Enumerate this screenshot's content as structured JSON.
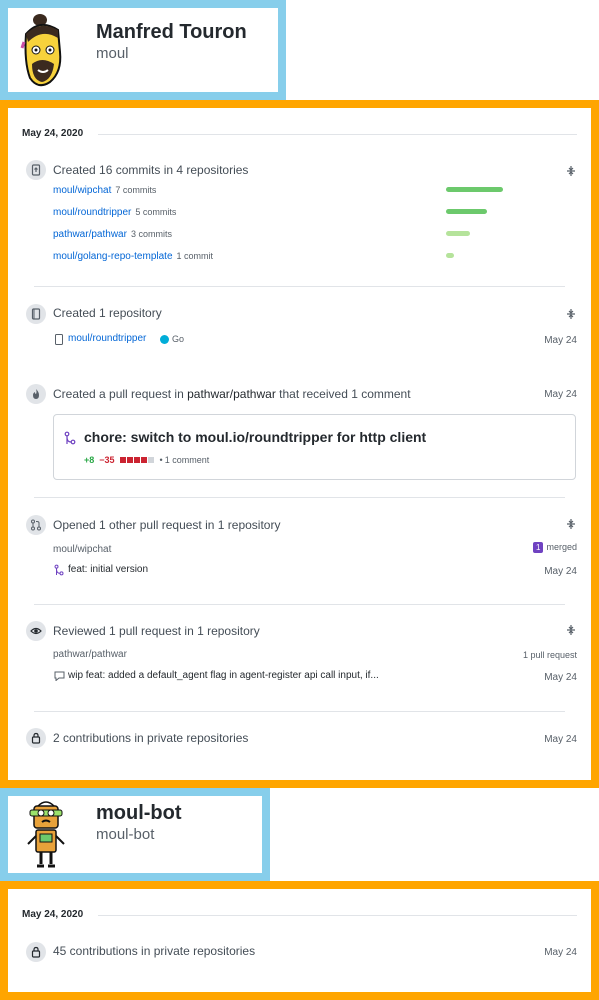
{
  "users": [
    {
      "name": "Manfred Touron",
      "login": "moul",
      "date_header": "May 24, 2020",
      "commits_event": {
        "title": "Created 16 commits in 4 repositories",
        "repos": [
          {
            "name": "moul/wipchat",
            "count": "7 commits",
            "commits": 7
          },
          {
            "name": "moul/roundtripper",
            "count": "5 commits",
            "commits": 5
          },
          {
            "name": "pathwar/pathwar",
            "count": "3 commits",
            "commits": 3
          },
          {
            "name": "moul/golang-repo-template",
            "count": "1 commit",
            "commits": 1
          }
        ]
      },
      "repo_event": {
        "title": "Created 1 repository",
        "repo_name": "moul/roundtripper",
        "language": "Go",
        "language_color": "#00ADD8",
        "date": "May 24"
      },
      "pr_event": {
        "title_prefix": "Created a pull request in",
        "repo": "pathwar/pathwar",
        "title_suffix": "that received 1 comment",
        "date": "May 24",
        "pr_title": "chore: switch to moul.io/roundtripper for http client",
        "additions": "+8",
        "deletions": "−35",
        "comments": "1 comment"
      },
      "opened_event": {
        "title": "Opened 1 other pull request in 1 repository",
        "repo": "moul/wipchat",
        "badge_count": "1",
        "badge_label": "merged",
        "pr_title": "feat: initial version",
        "date": "May 24"
      },
      "review_event": {
        "title": "Reviewed 1 pull request in 1 repository",
        "repo": "pathwar/pathwar",
        "count_label": "1 pull request",
        "pr_title": "wip feat: added a default_agent flag in agent-register api call input, if...",
        "date": "May 24"
      },
      "private_event": {
        "title": "2 contributions in private repositories",
        "date": "May 24"
      }
    },
    {
      "name": "moul-bot",
      "login": "moul-bot",
      "date_header": "May 24, 2020",
      "private_event": {
        "title": "45 contributions in private repositories",
        "date": "May 24"
      }
    }
  ],
  "colors": {
    "profile_border": "#87ceeb",
    "activity_border": "#ffa500",
    "link": "#0366d6",
    "merged": "#6f42c1",
    "bar_dark": "#6cc96c",
    "bar_light": "#b5e39b"
  }
}
